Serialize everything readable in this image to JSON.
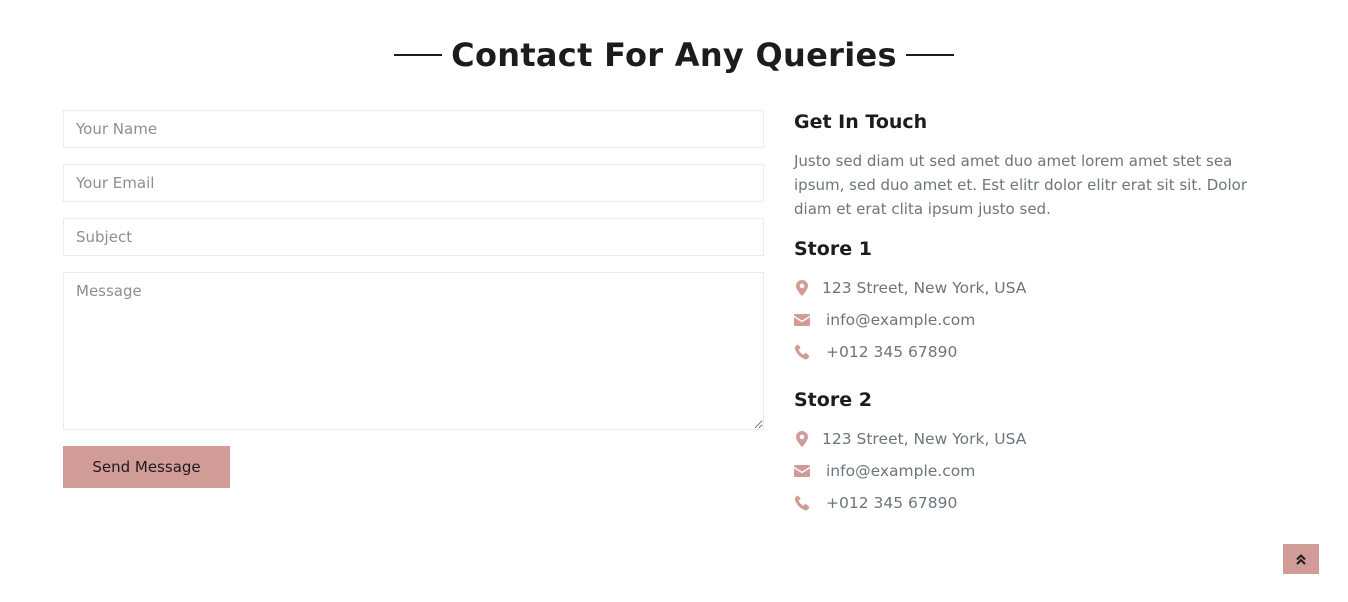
{
  "section_title": "Contact For Any Queries",
  "form": {
    "name_placeholder": "Your Name",
    "email_placeholder": "Your Email",
    "subject_placeholder": "Subject",
    "message_placeholder": "Message",
    "send_label": "Send Message"
  },
  "info": {
    "heading": "Get In Touch",
    "description": "Justo sed diam ut sed amet duo amet lorem amet stet sea ipsum, sed duo amet et. Est elitr dolor elitr erat sit sit. Dolor diam et erat clita ipsum justo sed.",
    "stores": [
      {
        "title": "Store 1",
        "address": "123 Street, New York, USA",
        "email": "info@example.com",
        "phone": "+012 345 67890"
      },
      {
        "title": "Store 2",
        "address": "123 Street, New York, USA",
        "email": "info@example.com",
        "phone": "+012 345 67890"
      }
    ]
  },
  "icons": {
    "address": "map-marker-icon",
    "email": "envelope-icon",
    "phone": "phone-icon",
    "back_to_top": "double-chevron-up-icon"
  },
  "colors": {
    "primary": "#d19c97",
    "dark": "#1c1c1c",
    "text": "#6c757d",
    "border": "#e9ecf5"
  }
}
